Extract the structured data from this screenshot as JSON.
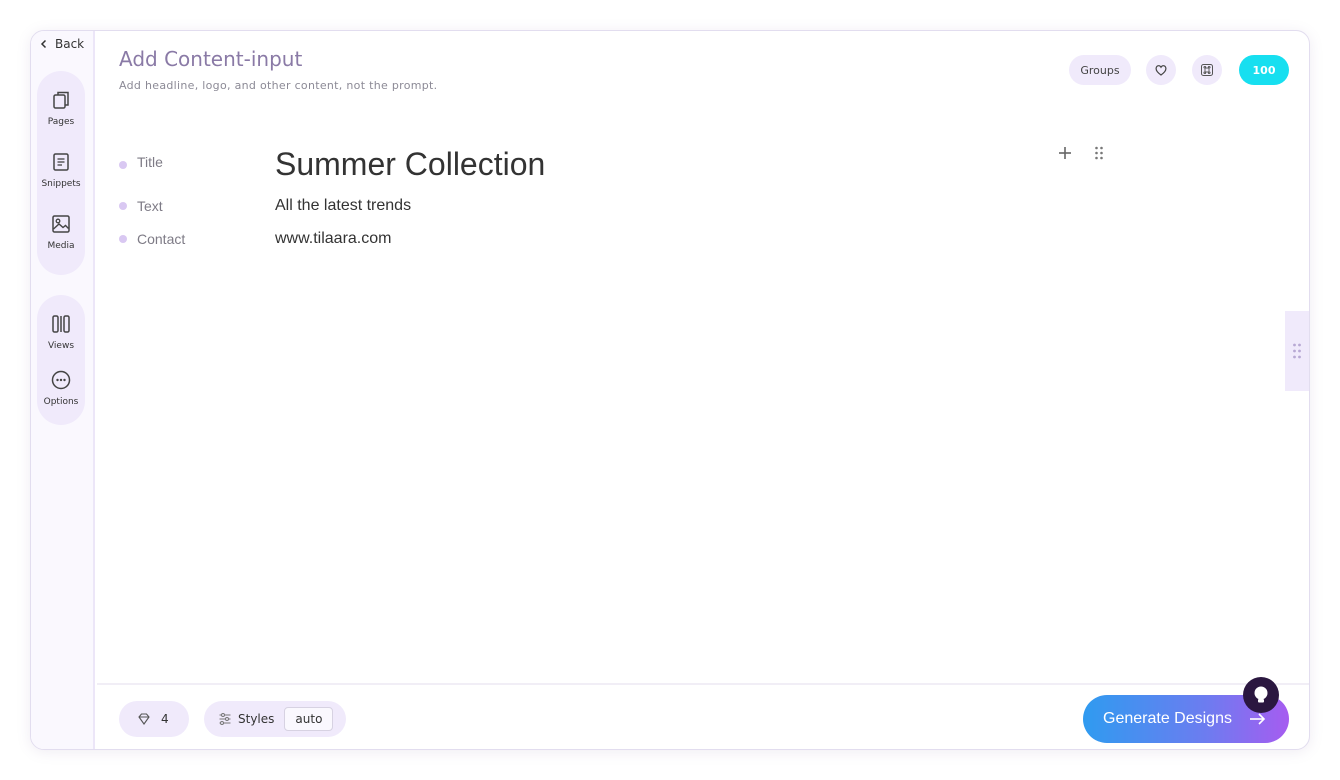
{
  "sidebar": {
    "back_label": "Back",
    "items": [
      {
        "label": "Pages",
        "icon": "pages-icon"
      },
      {
        "label": "Snippets",
        "icon": "snippets-icon"
      },
      {
        "label": "Media",
        "icon": "media-icon"
      },
      {
        "label": "Views",
        "icon": "views-icon"
      },
      {
        "label": "Options",
        "icon": "options-icon"
      }
    ]
  },
  "header": {
    "title": "Add Content-input",
    "subtitle": "Add headline, logo, and other content, not the prompt.",
    "groups_label": "Groups",
    "credits": "100"
  },
  "content": {
    "rows": [
      {
        "label": "Title",
        "value": "Summer Collection"
      },
      {
        "label": "Text",
        "value": "All the latest trends"
      },
      {
        "label": "Contact",
        "value": "www.tilaara.com"
      }
    ]
  },
  "footer": {
    "gem_count": "4",
    "styles_label": "Styles",
    "styles_value": "auto",
    "generate_label": "Generate Designs"
  },
  "colors": {
    "accent": "#8a7aa6",
    "pill_bg": "#f0eafb",
    "credits_bg": "#17dff0",
    "generate_start": "#2f9bf0",
    "generate_end": "#a65cf0"
  }
}
